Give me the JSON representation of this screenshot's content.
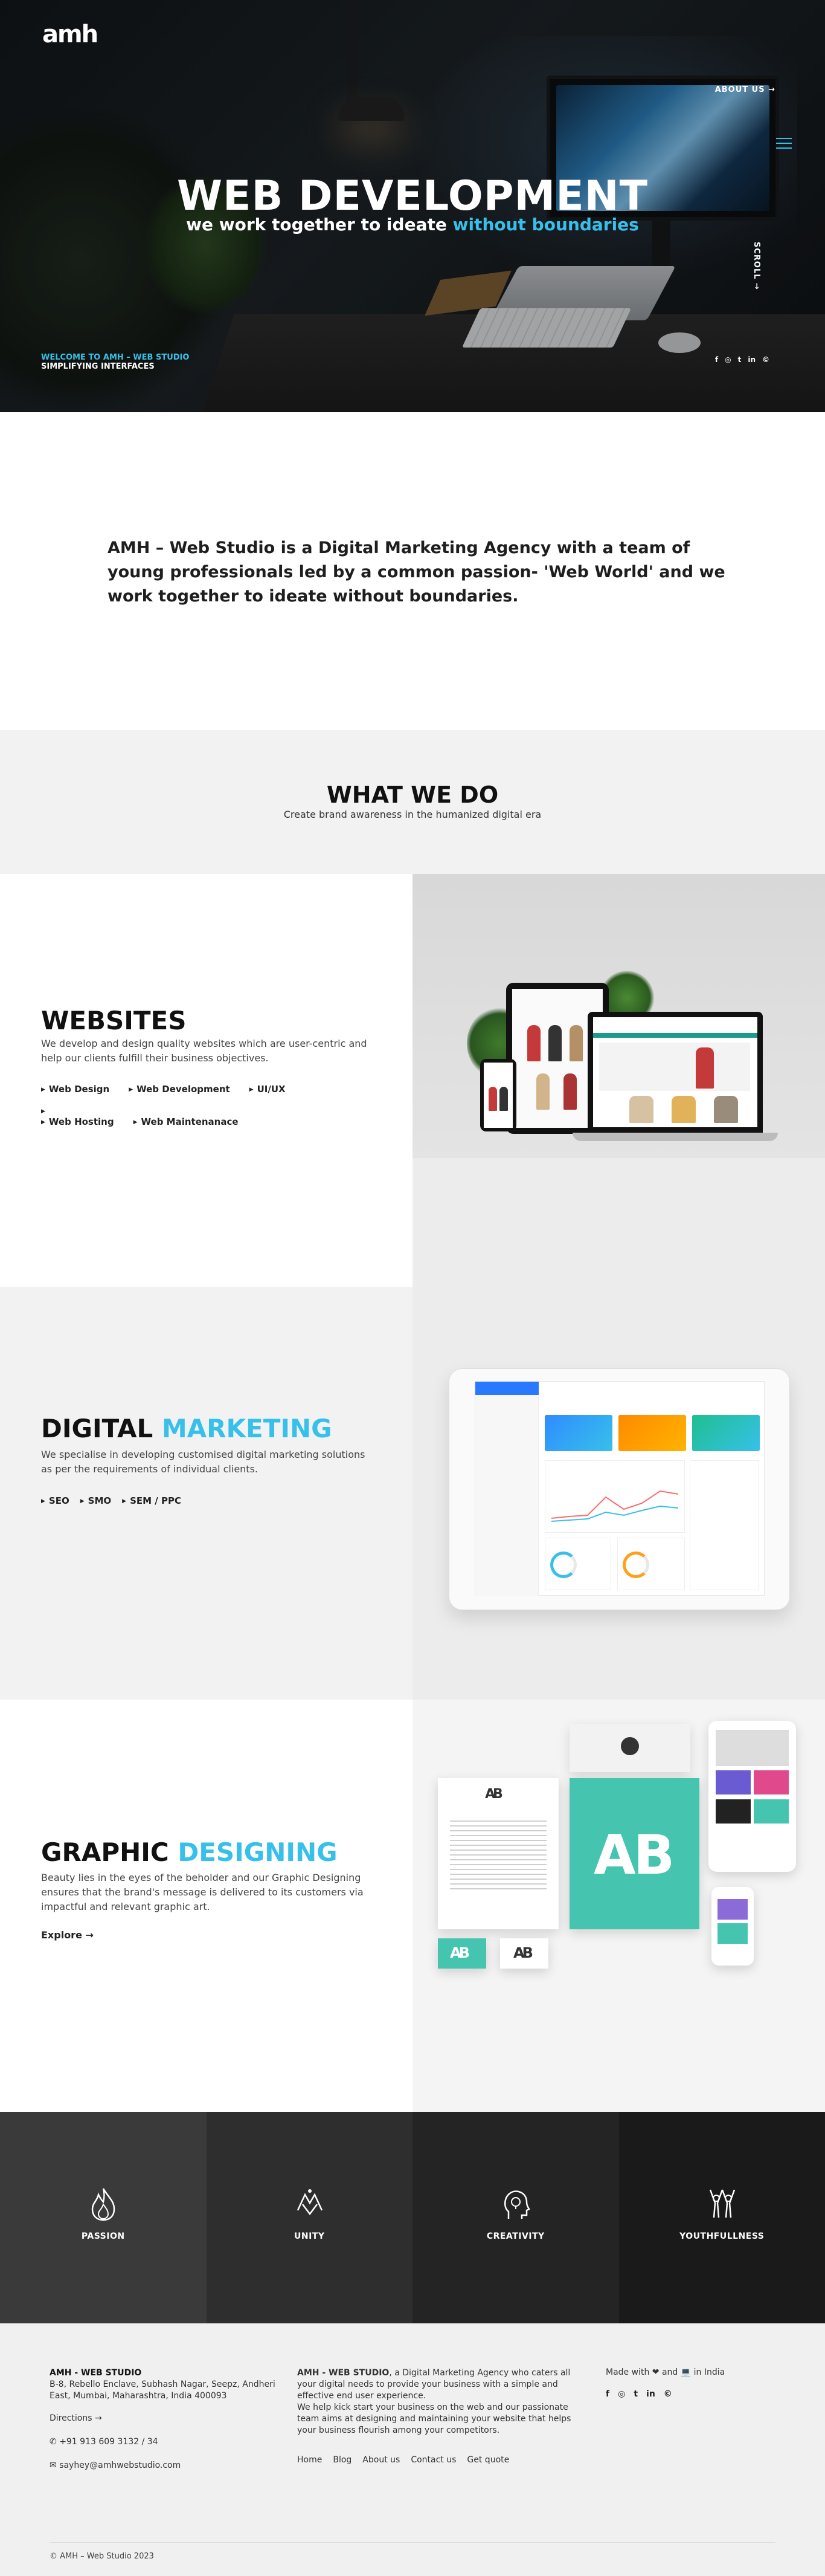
{
  "brand": {
    "logo_text": "amh",
    "accent_color": "#37c0ea"
  },
  "nav": {
    "about_label": "ABOUT US →",
    "menu_icon": "hamburger-icon"
  },
  "hero": {
    "title": "WEB DEVELOPMENT",
    "subtitle_prefix": "we work together to ideate ",
    "subtitle_highlight": "without boundaries",
    "scroll_label": "SCROLL →",
    "welcome": "WELCOME TO AMH – WEB STUDIO",
    "tagline": "SIMPLIFYING INTERFACES",
    "socials": [
      "f",
      "◎",
      "t",
      "in",
      "©"
    ]
  },
  "intro": {
    "text": "AMH – Web Studio is a Digital Marketing Agency with a team of young professionals led by a common passion- 'Web World' and we work together to ideate without boundaries."
  },
  "what_we_do": {
    "title": "WHAT WE DO",
    "subtitle": "Create brand awareness in the humanized digital era"
  },
  "services": {
    "websites": {
      "title": "WEBSITES",
      "description": "We develop and design quality websites which are user-centric and help our clients fulfill their business objectives.",
      "tags": [
        "Web Design",
        "Web Development",
        "UI/UX",
        "Web Hosting",
        "Web Maintenanace"
      ]
    },
    "digital_marketing": {
      "title_prefix": "DIGITAL ",
      "title_highlight": "MARKETING",
      "description": "We specialise in developing customised digital marketing solutions as per the requirements of individual clients.",
      "tags": [
        "SEO",
        "SMO",
        "SEM / PPC"
      ]
    },
    "graphic_designing": {
      "title_prefix": "GRAPHIC ",
      "title_highlight": "DESIGNING",
      "description": "Beauty lies in the eyes of the beholder and our Graphic Designing ensures that the brand's message is delivered to its customers via impactful and relevant graphic art.",
      "explore_label": "Explore →",
      "mockup_letters": "AB"
    }
  },
  "values": [
    {
      "label": "PASSION",
      "icon": "flame-icon"
    },
    {
      "label": "UNITY",
      "icon": "handshake-icon"
    },
    {
      "label": "CREATIVITY",
      "icon": "lightbulb-head-icon"
    },
    {
      "label": "YOUTHFULLNESS",
      "icon": "cheering-people-icon"
    }
  ],
  "footer": {
    "studio_name": "AMH - WEB STUDIO",
    "address": "B-8, Rebello Enclave, Subhash Nagar, Seepz, Andheri East, Mumbai, Maharashtra, India 400093",
    "directions": "Directions →",
    "phone": "+91 913 609 3132 / 34",
    "email": "sayhey@amhwebstudio.com",
    "about_bold": "AMH - WEB STUDIO",
    "about_text": ", a Digital Marketing Agency who caters all your digital needs to provide your business with a simple and effective end user experience.",
    "about_text2": "We help kick start your business on the web and our passionate team aims at designing and maintaining your website that helps your business flourish among your competitors.",
    "links": [
      "Home",
      "Blog",
      "About us",
      "Contact us",
      "Get quote"
    ],
    "made_with": "Made with",
    "and": "and",
    "in_india": "in India",
    "socials": [
      "f",
      "◎",
      "t",
      "in",
      "©"
    ],
    "copyright": "© AMH – Web Studio 2023"
  }
}
